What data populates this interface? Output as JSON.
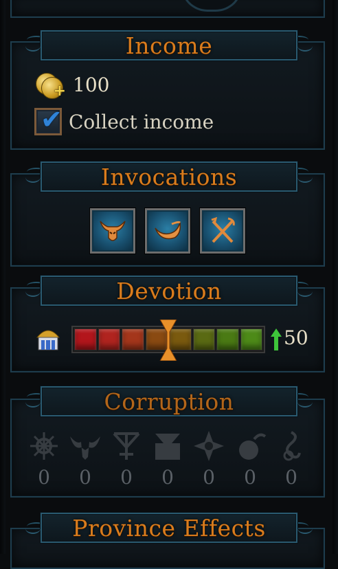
{
  "income": {
    "title": "Income",
    "amount": "100",
    "collect_label": "Collect income",
    "collect_checked": true,
    "coin_icon": "gold-coins-plus-icon"
  },
  "invocations": {
    "title": "Invocations",
    "items": [
      {
        "icon": "horned-skull-icon"
      },
      {
        "icon": "crescent-horn-icon"
      },
      {
        "icon": "crossed-weapons-icon"
      }
    ]
  },
  "devotion": {
    "title": "Devotion",
    "value": "50",
    "trend": "up",
    "level_fraction": 0.5,
    "segment_colors": [
      "#b3161c",
      "#b0241f",
      "#a4361b",
      "#8a4a12",
      "#7a5a0f",
      "#5a6a13",
      "#4a7a14",
      "#4d8a18"
    ]
  },
  "corruption": {
    "title": "Corruption",
    "items": [
      {
        "icon": "chaos-wheel-icon",
        "value": "0"
      },
      {
        "icon": "vampire-bat-icon",
        "value": "0"
      },
      {
        "icon": "skaven-sigil-icon",
        "value": "0"
      },
      {
        "icon": "khorne-skull-icon",
        "value": "0"
      },
      {
        "icon": "chaos-star-icon",
        "value": "0"
      },
      {
        "icon": "nurgle-flask-icon",
        "value": "0"
      },
      {
        "icon": "slaanesh-curl-icon",
        "value": "0"
      }
    ]
  },
  "province_effects": {
    "title": "Province Effects"
  }
}
